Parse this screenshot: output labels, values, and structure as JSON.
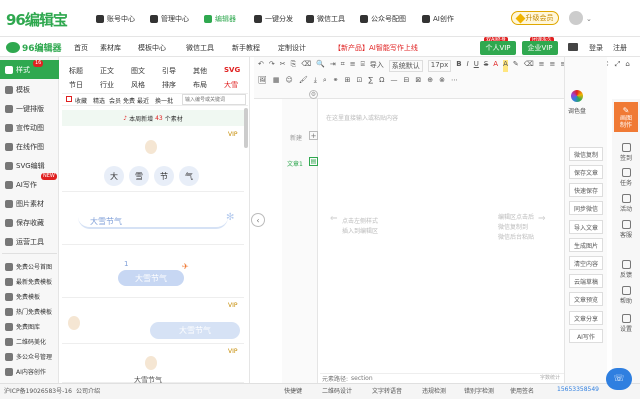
{
  "brand": {
    "logo": "96编辑宝",
    "logo2": "96编辑器"
  },
  "topnav": [
    "账号中心",
    "管理中心",
    "编辑器",
    "一键分发",
    "微信工具",
    "公众号配图",
    "AI创作"
  ],
  "upgrade": "升级会员",
  "nav2": {
    "items": [
      "首页",
      "素材库",
      "模板中心",
      "微信工具",
      "新手教程",
      "定制设计"
    ],
    "promo": "【新产品】AI智能写作上线",
    "vip1": "个人VIP",
    "vip1_tag": "双AI终身",
    "vip2": "企业VIP",
    "vip2_tag": "团课永久",
    "login": "登录",
    "register": "注册"
  },
  "sidebar": [
    {
      "label": "样式",
      "badge": "16",
      "active": true
    },
    {
      "label": "模板"
    },
    {
      "label": "一键排版"
    },
    {
      "label": "宣传动图"
    },
    {
      "label": "在线作图"
    },
    {
      "label": "SVG编辑"
    },
    {
      "label": "AI写作",
      "badge": "NEW"
    },
    {
      "label": "图片素材"
    },
    {
      "label": "保存收藏"
    },
    {
      "label": "运营工具"
    },
    {
      "label": "免费公号首图"
    },
    {
      "label": "最新免费模板"
    },
    {
      "label": "免费模板"
    },
    {
      "label": "热门免费模板"
    },
    {
      "label": "免费图库"
    },
    {
      "label": "二维码美化"
    },
    {
      "label": "多公众号管理"
    },
    {
      "label": "AI内容创作"
    }
  ],
  "panel": {
    "cats_row1": [
      "标题",
      "正文",
      "图文",
      "引导",
      "其他",
      "SVG"
    ],
    "cats_row2": [
      "节日",
      "行业",
      "风格",
      "排序",
      "布局",
      "大雪"
    ],
    "filters": [
      "收藏",
      "精选",
      "会员",
      "免费",
      "最近",
      "换一批"
    ],
    "search_placeholder": "输入编号或关键词",
    "notice_pre": "本周新增",
    "notice_count": "43",
    "notice_post": "个素材",
    "card1_chars": [
      "大",
      "雪",
      "节",
      "气"
    ],
    "card2_text": "大雪节气",
    "card3_num": "1",
    "card3_text": "大雪节气",
    "card4_text": "大雪节气",
    "card5_text": "大雪节气",
    "vip": "VIP"
  },
  "toolbar": {
    "row1": [
      "↶",
      "↷",
      "✂",
      "⎘",
      "⌫",
      "🔍",
      "⇥",
      "⌗",
      "≡",
      "⌸",
      "导入",
      "系统默认",
      "17px",
      "B",
      "I",
      "U",
      "S",
      "A",
      "A",
      "✎",
      "⌫",
      "≡",
      "≡",
      "≡",
      "≡",
      "≡",
      "↔",
      "↕",
      "⤢",
      "⌂"
    ],
    "row2": [
      "🖼",
      "▦",
      "☺",
      "🖌",
      "⤓",
      "⌕",
      "⚭",
      "⊞",
      "⊡",
      "∑",
      "Ω",
      "—",
      "⊟",
      "⊠",
      "⊕",
      "⊗",
      "⋯"
    ]
  },
  "doc_col": {
    "new": "新建",
    "doc1": "文章1"
  },
  "canvas": {
    "hint_top": "在这里直接输入或粘贴内容",
    "hint_left1": "点击左侧样式",
    "hint_left2": "插入到编辑区",
    "hint_right1": "编辑区点击后",
    "hint_right2": "微信复制到",
    "hint_right3": "微信后台粘贴",
    "path_label": "元素路径:",
    "path_value": "section",
    "wordcount": "字数统计"
  },
  "rside": {
    "top_label": "调色盘",
    "buttons": [
      "微信复制",
      "保存文章",
      "快速保存",
      "同步微信",
      "导入文章",
      "生成图片",
      "清空内容",
      "云端草稿",
      "文章预览",
      "文章分享",
      "AI写作"
    ]
  },
  "farright": {
    "top": "画图\n制作",
    "items": [
      "签到",
      "任务",
      "活动",
      "客服",
      "反馈",
      "帮助",
      "设置"
    ]
  },
  "bottom": {
    "icp": "沪ICP备19026583号-16",
    "company": "公司介绍",
    "items": [
      "快捷键",
      "二维码设计",
      "文字转语音",
      "违规检测",
      "错别字检测",
      "使用签名"
    ],
    "phone": "15653358549"
  },
  "colors": {
    "green": "#2fa84f",
    "red": "#e02020",
    "orange": "#f07a35"
  }
}
